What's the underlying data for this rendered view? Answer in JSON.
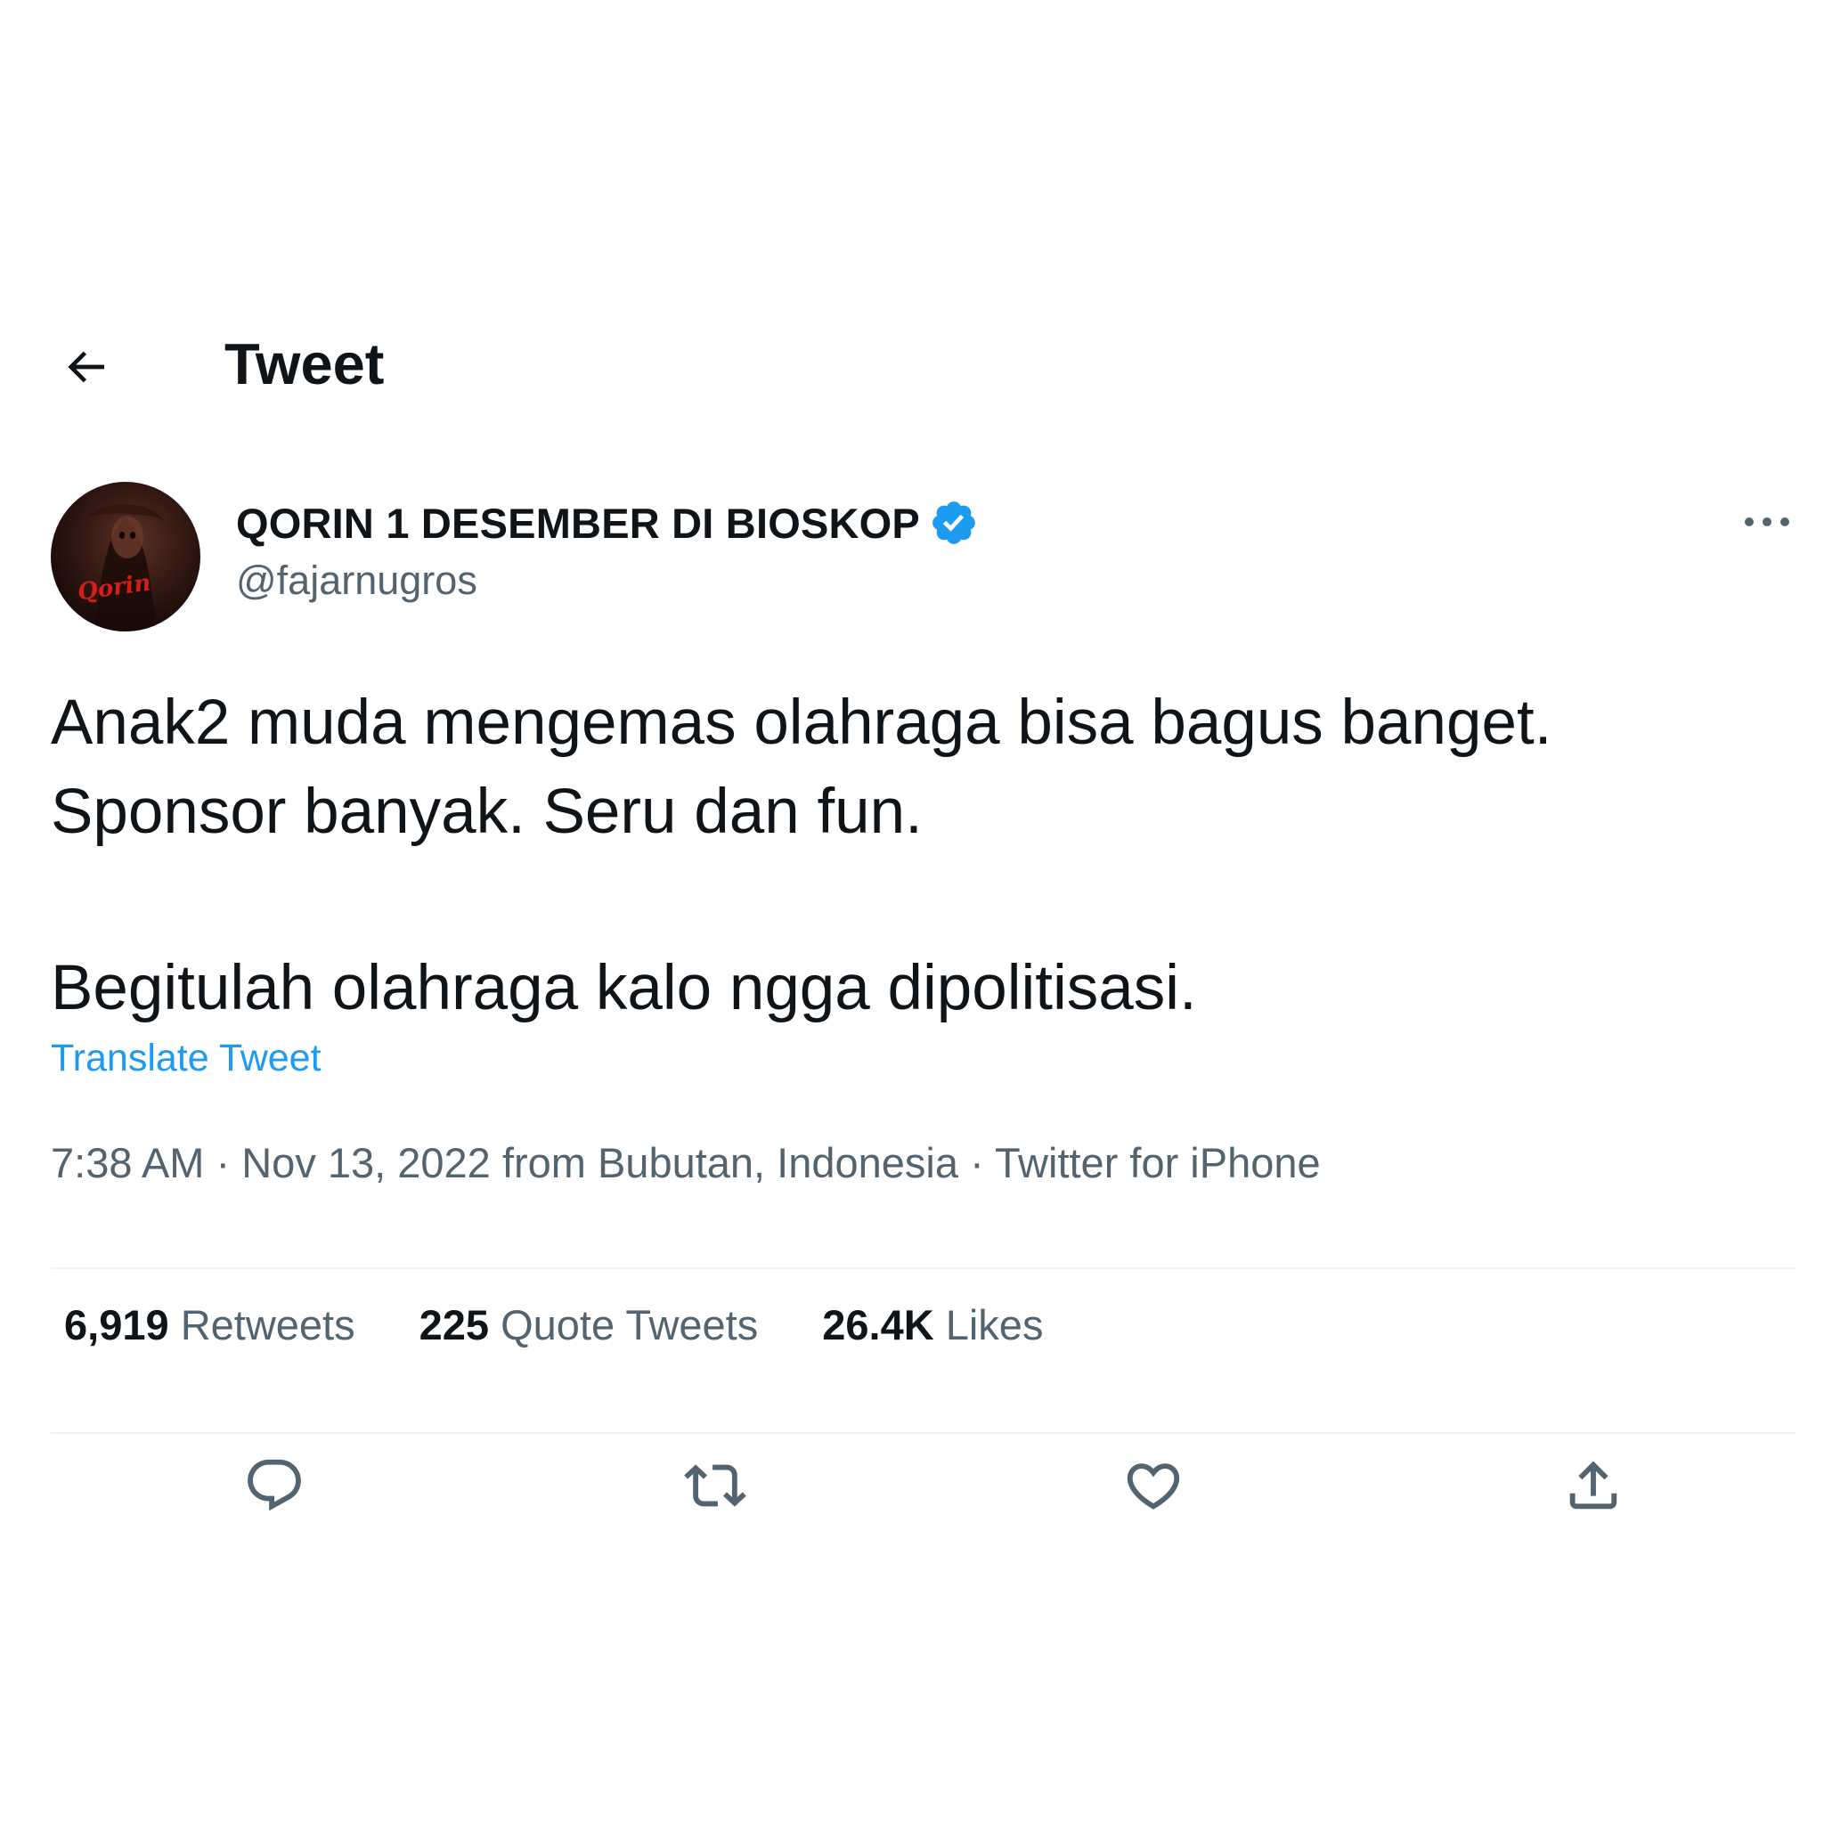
{
  "header": {
    "title": "Tweet",
    "back_icon": "arrow-left-icon"
  },
  "author": {
    "display_name": "QORIN 1 DESEMBER DI BIOSKOP",
    "handle": "@fajarnugros",
    "verified": true,
    "avatar_label": "Qorin"
  },
  "tweet": {
    "lines_paragraph1": [
      "Anak2 muda mengemas olahraga bisa bagus banget.",
      "Sponsor banyak. Seru dan fun."
    ],
    "paragraph2": "Begitulah olahraga kalo ngga dipolitisasi.",
    "translate_label": "Translate Tweet"
  },
  "meta": {
    "time": "7:38 AM",
    "separator": " · ",
    "date": "Nov 13, 2022",
    "location_prefix": " from ",
    "location": "Bubutan, Indonesia",
    "source": "Twitter for iPhone"
  },
  "stats": {
    "retweets_count": "6,919",
    "retweets_label": "Retweets",
    "quotes_count": "225",
    "quotes_label": "Quote Tweets",
    "likes_count": "26.4K",
    "likes_label": "Likes"
  },
  "actions": [
    "reply-icon",
    "retweet-icon",
    "like-icon",
    "share-icon"
  ],
  "colors": {
    "text_primary": "#0f1419",
    "text_secondary": "#536471",
    "link": "#1d9bf0",
    "verified": "#1d9bf0",
    "divider": "#eff3f4"
  }
}
